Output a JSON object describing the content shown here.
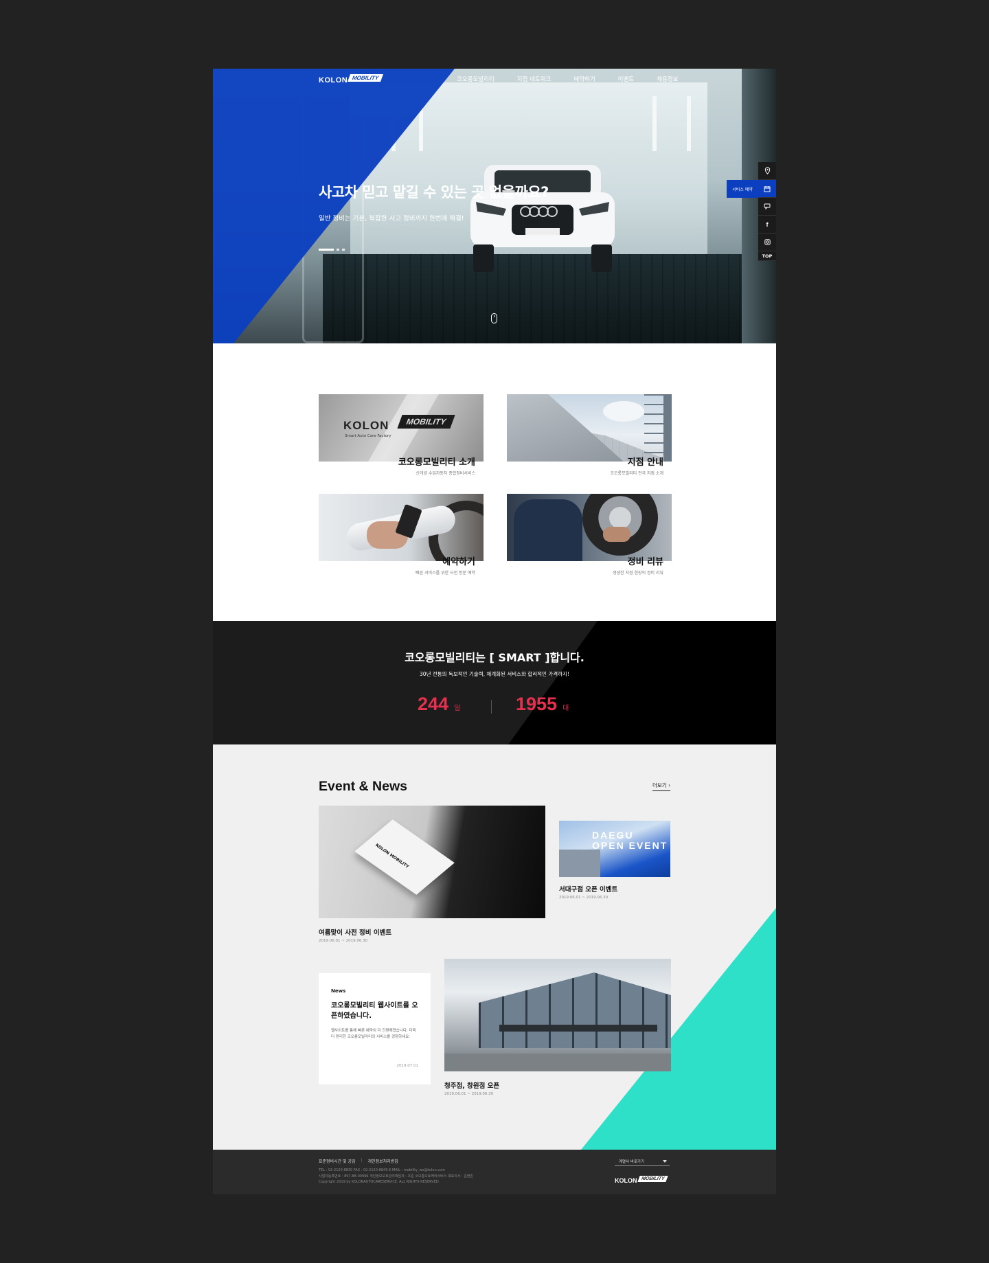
{
  "header": {
    "logo_kolon": "KOLON",
    "logo_mobility": "MOBILITY",
    "menu": [
      "코오롱모빌리티",
      "지점 네트워크",
      "예약하기",
      "이벤트",
      "채용정보"
    ]
  },
  "hero": {
    "title": "사고차 믿고 맡길 수 있는 곳 없을까요?",
    "subtitle": "일반 정비는 기본, 복잡한 사고 정비까지 한번에 해결!"
  },
  "quick_menu": {
    "service_label": "서비스 예약",
    "items": [
      "location-icon",
      "calendar-icon",
      "chat-icon",
      "facebook-icon",
      "instagram-icon"
    ],
    "top_label": "TOP"
  },
  "services": [
    {
      "title": "코오롱모빌리티 소개",
      "desc": "신개념 수입자동차 종합정비서비스",
      "image_logo": "KOLON",
      "image_badge": "MOBILITY",
      "image_caption": "Smart Auto Care Factory"
    },
    {
      "title": "지점 안내",
      "desc": "코오롱모빌리티 전국 지점 소개"
    },
    {
      "title": "예약하기",
      "desc": "빠른 서비스를 위한 사전 방문 예약"
    },
    {
      "title": "정비 리뷰",
      "desc": "생생한 지점 현장의 정비 리뷰"
    }
  ],
  "smart": {
    "title": "코오롱모빌리티는 [ SMART ]합니다.",
    "subtitle": "30년 전통의 독보적인 기술력, 체계화된 서비스와 합리적인 가격까지!",
    "stats": [
      {
        "value": "244",
        "unit": "일"
      },
      {
        "value": "1955",
        "unit": "대"
      }
    ]
  },
  "events": {
    "section_title": "Event & News",
    "more_label": "더보기",
    "items": [
      {
        "label": "여름맞이 사전 정비 이벤트",
        "date": "2019.06.01 ~ 2019.06.30"
      },
      {
        "label": "서대구점 오픈 이벤트",
        "date": "2019.06.01 ~ 2019.06.30",
        "image_text": "DAEGU OPEN EVENT"
      },
      {
        "label": "청주점, 창원점 오픈",
        "date": "2019.06.01 ~ 2019.06.30"
      }
    ],
    "news": {
      "tag": "News",
      "title": "코오롱모빌리티 웹사이트를 오픈하였습니다.",
      "body": "웹사이트를 통해 빠른 예약이 더 간편해졌습니다. 더욱 더 편리한 코오롱모빌리티의 서비스를 경험하세요.",
      "date": "2019.07.01"
    }
  },
  "footer": {
    "links": [
      "표준정비시간 및 공임",
      "개인정보처리방침"
    ],
    "info_lines": [
      "TEL : 02-2120-8830    FAX : 02-2120-8849    E-MAIL : mobility_ws@kolon.com",
      "사업자등록번호 : 897-88-00996    개인정보보호관리책임자 : 조준    코오롱오토케어서비스 대표이사 : 김현민",
      "Copyright 2019 by KOLONAUTOCARESERVICE. ALL RIGHTS RESERVED."
    ],
    "family_site": "계열사 바로가기",
    "logo_kolon": "KOLON",
    "logo_mobility": "MOBILITY"
  },
  "colors": {
    "accent_blue": "#0b3fbf",
    "stat_red": "#e5304e",
    "teal": "#2fe0c9"
  }
}
